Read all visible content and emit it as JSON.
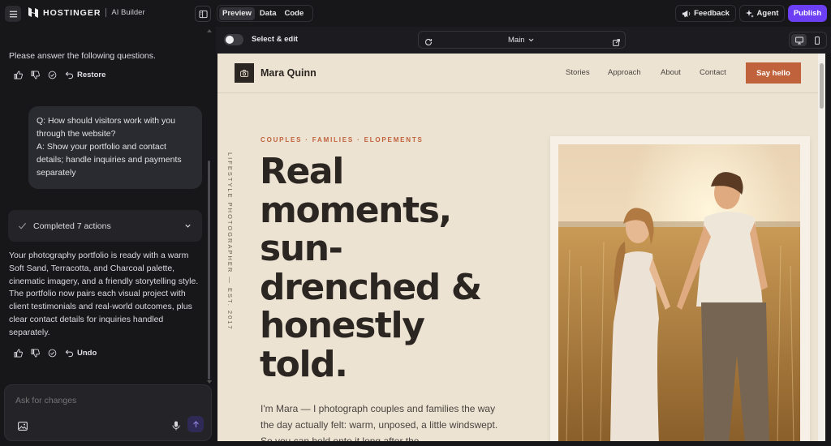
{
  "app": {
    "brand": "HOSTINGER",
    "product": "AI Builder",
    "view_tabs": [
      "Preview",
      "Data",
      "Code"
    ],
    "active_view": "Preview",
    "feedback_label": "Feedback",
    "agent_label": "Agent",
    "publish_label": "Publish"
  },
  "chat": {
    "message1": "Please answer the following questions.",
    "restore_label": "Restore",
    "user_message": {
      "line1": "Q: How should visitors work with you through the website?",
      "line2": "A: Show your portfolio and contact details; handle inquiries and payments separately"
    },
    "completed_label": "Completed 7 actions",
    "message2": "Your photography portfolio is ready with a warm Soft Sand, Terracotta, and Charcoal palette, cinematic imagery, and a friendly storytelling style. The portfolio now pairs each visual project with client testimonials and real-world outcomes, plus clear contact details for inquiries handled separately.",
    "undo_label": "Undo",
    "input_placeholder": "Ask for changes"
  },
  "preview": {
    "select_edit_label": "Select & edit",
    "select_edit_enabled": false,
    "page_name": "Main",
    "device": "desktop"
  },
  "site": {
    "brand_name": "Mara Quinn",
    "nav": [
      "Stories",
      "Approach",
      "About",
      "Contact"
    ],
    "cta": "Say hello",
    "vertical_tag": "LIFESTYLE PHOTOGRAPHER — EST. 2017",
    "eyebrow": "COUPLES · FAMILIES · ELOPEMENTS",
    "headline": [
      "Real",
      "moments,",
      "sun-",
      "drenched &",
      "honestly",
      "told."
    ],
    "intro": "I'm Mara — I photograph couples and families the way the day actually felt: warm, unposed, a little windswept. So you can hold onto it long after the",
    "colors": {
      "sand": "#ede3d2",
      "terracotta": "#c0623c",
      "charcoal": "#2b2622"
    }
  },
  "colors": {
    "accent": "#6c3ff5"
  }
}
